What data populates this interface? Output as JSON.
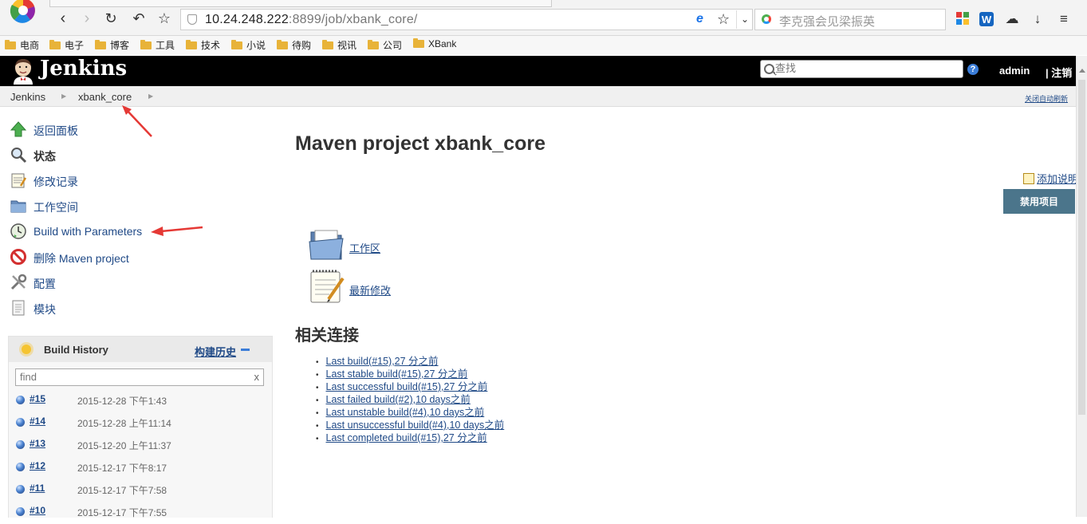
{
  "browser": {
    "url_host": "10.24.248.222",
    "url_rest": ":8899/job/xbank_core/",
    "search_placeholder": "李克强会见梁振英",
    "bookmarks": [
      "电商",
      "电子",
      "博客",
      "工具",
      "技术",
      "小说",
      "待购",
      "视讯",
      "公司",
      "XBank"
    ]
  },
  "header": {
    "logo_text": "Jenkins",
    "search_placeholder": "查找",
    "help_label": "?",
    "user": "admin",
    "logout": "| 注销"
  },
  "breadcrumbs": {
    "items": [
      "Jenkins",
      "xbank_core"
    ],
    "auto_refresh": "关闭自动刷新"
  },
  "tasks": [
    {
      "label": "返回面板",
      "icon": "up-arrow-icon"
    },
    {
      "label": "状态",
      "icon": "magnifier-icon"
    },
    {
      "label": "修改记录",
      "icon": "notepad-icon"
    },
    {
      "label": "工作空间",
      "icon": "folder-icon"
    },
    {
      "label": "Build with Parameters",
      "icon": "clock-icon"
    },
    {
      "label": "删除 Maven project",
      "icon": "no-entry-icon"
    },
    {
      "label": "配置",
      "icon": "tools-icon"
    },
    {
      "label": "模块",
      "icon": "document-icon"
    }
  ],
  "build_history": {
    "title": "Build History",
    "trend_label": "构建历史",
    "filter_placeholder": "find",
    "clear_label": "x",
    "builds": [
      {
        "number": "#15",
        "date": "2015-12-28 下午1:43"
      },
      {
        "number": "#14",
        "date": "2015-12-28 上午11:14"
      },
      {
        "number": "#13",
        "date": "2015-12-20 上午11:37"
      },
      {
        "number": "#12",
        "date": "2015-12-17 下午8:17"
      },
      {
        "number": "#11",
        "date": "2015-12-17 下午7:58"
      },
      {
        "number": "#10",
        "date": "2015-12-17 下午7:55"
      }
    ]
  },
  "main": {
    "title": "Maven project xbank_core",
    "add_description": "添加说明",
    "disable_button": "禁用项目",
    "workspace_link": "工作区",
    "changes_link": "最新修改",
    "permalinks_title": "相关连接",
    "permalinks": [
      "Last build(#15),27 分之前",
      "Last stable build(#15),27 分之前",
      "Last successful build(#15),27 分之前",
      "Last failed build(#2),10 days之前",
      "Last unstable build(#4),10 days之前",
      "Last unsuccessful build(#4),10 days之前",
      "Last completed build(#15),27 分之前"
    ]
  },
  "colors": {
    "header_bg": "#000000",
    "link": "#204a87",
    "disable_button_bg": "#4b758b",
    "annotation_arrow": "#e53935"
  }
}
